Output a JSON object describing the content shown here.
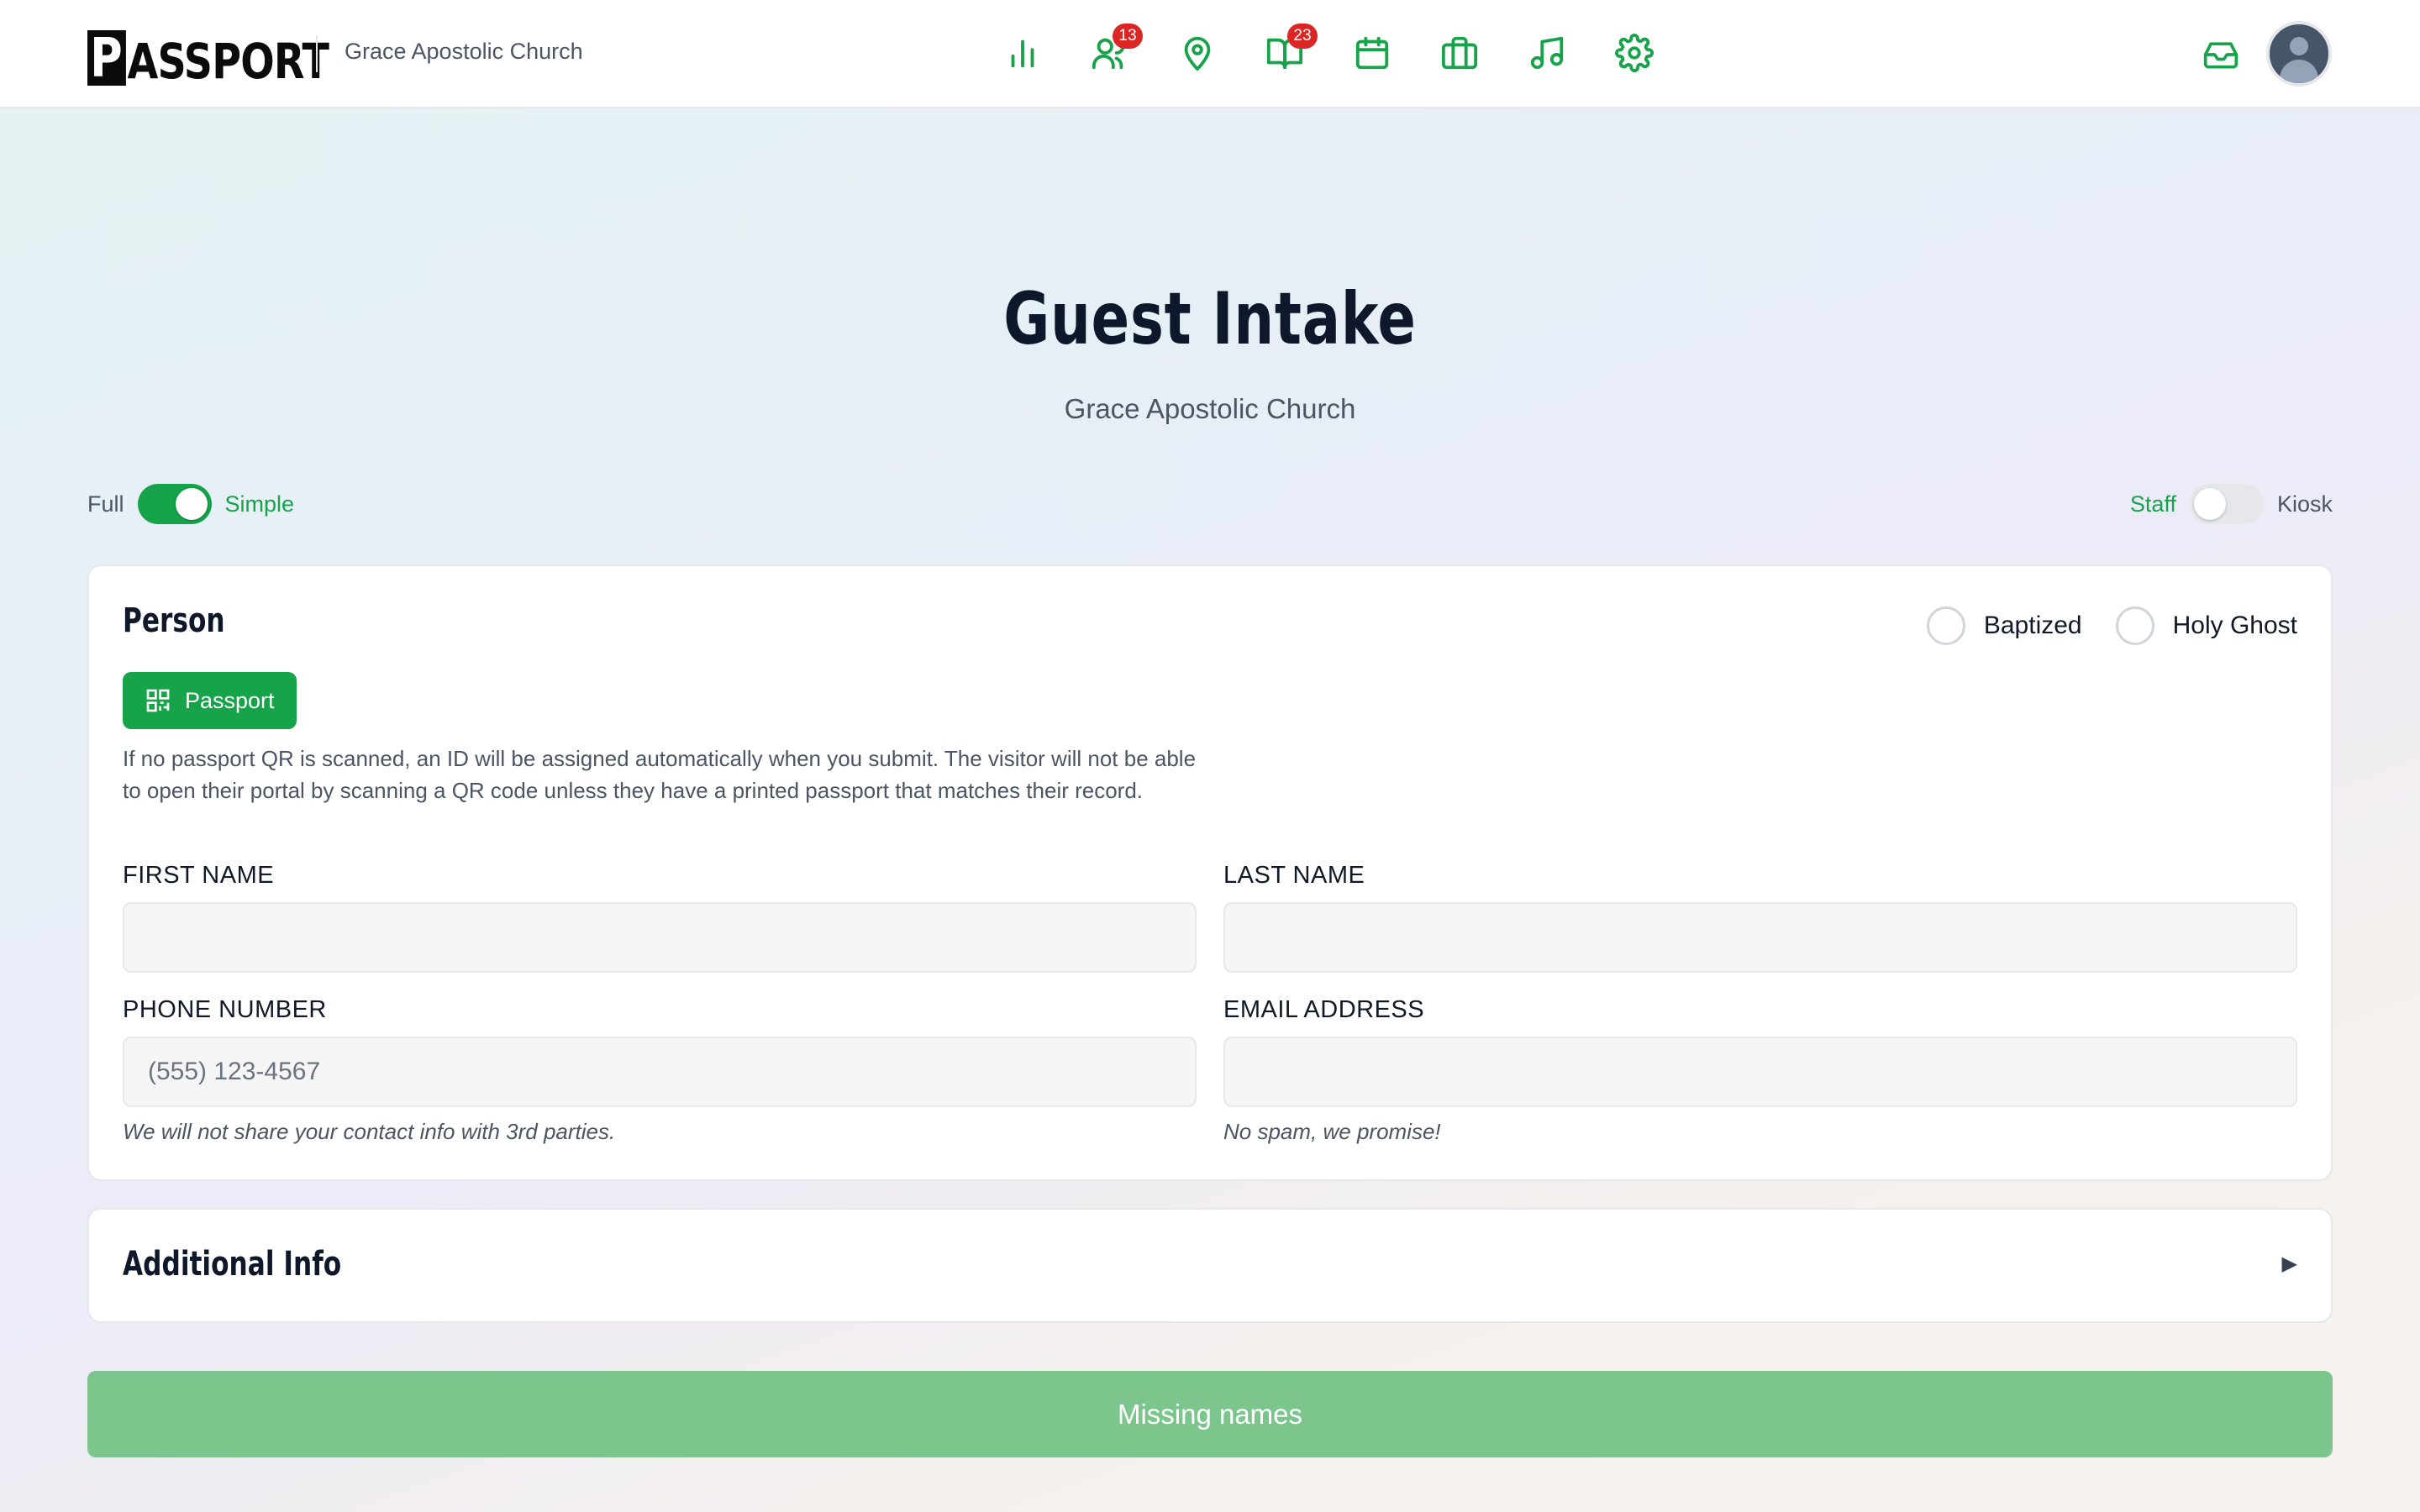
{
  "header": {
    "logo_text": "ASSPORT",
    "logo_mark": "P",
    "org_name": "Grace Apostolic Church",
    "nav": [
      {
        "icon": "bar-chart-icon",
        "badge": ""
      },
      {
        "icon": "users-icon",
        "badge": "13"
      },
      {
        "icon": "map-pin-icon",
        "badge": ""
      },
      {
        "icon": "book-open-icon",
        "badge": "23"
      },
      {
        "icon": "calendar-icon",
        "badge": ""
      },
      {
        "icon": "briefcase-icon",
        "badge": ""
      },
      {
        "icon": "music-icon",
        "badge": ""
      },
      {
        "icon": "gear-icon",
        "badge": ""
      }
    ],
    "right_icons": [
      "inbox-icon",
      "avatar"
    ]
  },
  "page": {
    "title": "Guest Intake",
    "subtitle": "Grace Apostolic Church"
  },
  "mode_toggle": {
    "left_label": "Full",
    "right_label": "Simple",
    "value": "Simple"
  },
  "role_toggle": {
    "left_label": "Staff",
    "right_label": "Kiosk",
    "value": "Staff"
  },
  "person": {
    "title": "Person",
    "checks": {
      "baptized": "Baptized",
      "holy_ghost": "Holy Ghost"
    },
    "passport_button": "Passport",
    "help_text": "If no passport QR is scanned, an ID will be assigned automatically when you submit. The visitor will not be able to open their portal by scanning a QR code unless they have a printed passport that matches their record.",
    "fields": {
      "first_name": {
        "label": "FIRST NAME",
        "value": "",
        "placeholder": ""
      },
      "last_name": {
        "label": "LAST NAME",
        "value": "",
        "placeholder": ""
      },
      "phone": {
        "label": "PHONE NUMBER",
        "value": "",
        "placeholder": "(555) 123-4567",
        "hint": "We will not share your contact info with 3rd parties."
      },
      "email": {
        "label": "EMAIL ADDRESS",
        "value": "",
        "placeholder": "",
        "hint": "No spam, we promise!"
      }
    }
  },
  "additional": {
    "title": "Additional Info",
    "caret": "▶"
  },
  "submit": {
    "label": "Missing names"
  },
  "colors": {
    "accent": "#16a34a",
    "badge": "#dc2626",
    "submit_disabled": "#7cc68e"
  }
}
